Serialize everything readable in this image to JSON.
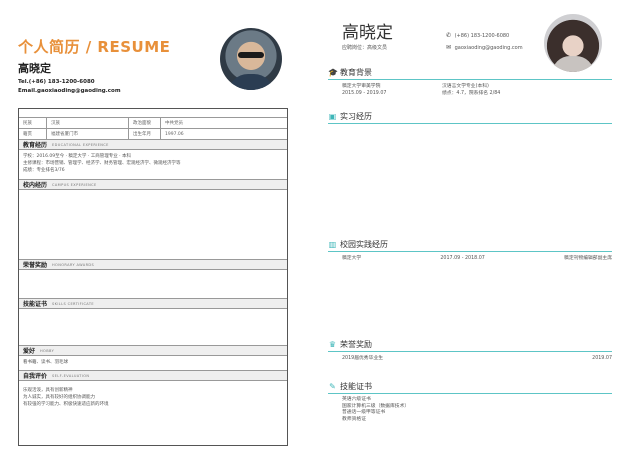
{
  "left": {
    "title": "个人简历 / RESUME",
    "name": "高晓定",
    "phone": "Tel.(+86) 183-1200-6080",
    "email": "Email.gaoxiaoding@gaoding.com",
    "info": [
      {
        "k1": "民族",
        "v1": "汉族",
        "k2": "政治面貌",
        "v2": "中共党员"
      },
      {
        "k1": "籍贯",
        "v1": "福建省厦门市",
        "k2": "出生年月",
        "v2": "1997.06"
      }
    ],
    "sections": {
      "education": {
        "zh": "教育经历",
        "en": "EDUCATIONAL EXPERIENCE",
        "lines": [
          "学校：2016.09至今 · 稿定大学 · 工商管理专业 · 本科",
          "主修课程：市场营销、管理学、经济学、财务管理、宏观经济学、微观经济学等",
          "成绩：专业排名3/76"
        ]
      },
      "campus": {
        "zh": "校内经历",
        "en": "CAMPUS EXPERIENCE"
      },
      "awards": {
        "zh": "荣誉奖励",
        "en": "HONORARY AWARDS"
      },
      "skills": {
        "zh": "技能证书",
        "en": "SKILLS CERTIFICATE"
      },
      "hobby": {
        "zh": "爱好",
        "en": "HOBBY",
        "lines": [
          "看书籍、读书、羽毛球"
        ]
      },
      "self": {
        "zh": "自我评价",
        "en": "SELF-EVALUATION",
        "lines": [
          "乐观活泼，具有创新精神",
          "为人诚实，具有较好的组织协调能力",
          "有较强的学习能力、积极快速适应新的环境"
        ]
      }
    }
  },
  "right": {
    "name": "高晓定",
    "subtitle": "应聘岗位：高级文员",
    "phone": "(+86) 183-1200-6080",
    "email": "gaoxiaoding@gaoding.com",
    "phone_icon": "phone-icon",
    "email_icon": "mail-icon",
    "accent": "#3eb6b8",
    "education": {
      "label": "教育背景",
      "school": "稿定大学审美学院",
      "major": "汉语言文学专业(本科)",
      "period": "2015.09 - 2019.07",
      "score": "绩点：4.7，院系排名 2/84"
    },
    "internship": {
      "label": "实习经历"
    },
    "campus": {
      "label": "校园实践经历",
      "org": "稿定大学",
      "period": "2017.09 - 2018.07",
      "role": "稿定刊物编辑部副主席"
    },
    "awards": {
      "label": "荣誉奖励",
      "item": "2019届优秀毕业生",
      "year": "2019.07"
    },
    "skills": {
      "label": "技能证书",
      "lines": [
        "英语六级证书",
        "国家计算机三级（数据库技术）",
        "普通话一级甲等证书",
        "教师资格证"
      ]
    }
  }
}
